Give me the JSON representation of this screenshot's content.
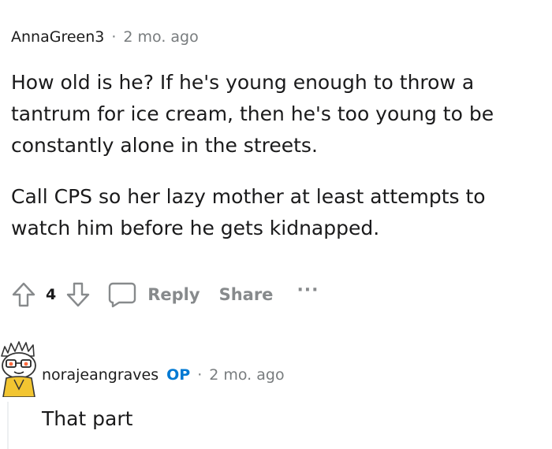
{
  "comment": {
    "username": "AnnaGreen3",
    "separator": "·",
    "timestamp": "2 mo. ago",
    "paragraphs": [
      "How old is he? If he's young enough to throw a tantrum for ice cream, then he's too young to be constantly alone in the streets.",
      "Call CPS so her lazy mother at least attempts to watch him before he gets kidnapped."
    ],
    "actions": {
      "vote_count": "4",
      "reply_label": "Reply",
      "share_label": "Share",
      "more_label": "···"
    }
  },
  "reply": {
    "username": "norajeangraves",
    "badge": "OP",
    "separator": "·",
    "timestamp": "2 mo. ago",
    "body": "That part"
  },
  "icons": {
    "upvote": "upvote-arrow-icon",
    "downvote": "downvote-arrow-icon",
    "reply": "speech-bubble-icon",
    "more": "more-dots-icon",
    "avatar": "snoo-avatar-icon"
  },
  "colors": {
    "text": "#1a1a1b",
    "meta": "#787c7e",
    "action": "#878a8c",
    "op_badge": "#0079d3"
  }
}
